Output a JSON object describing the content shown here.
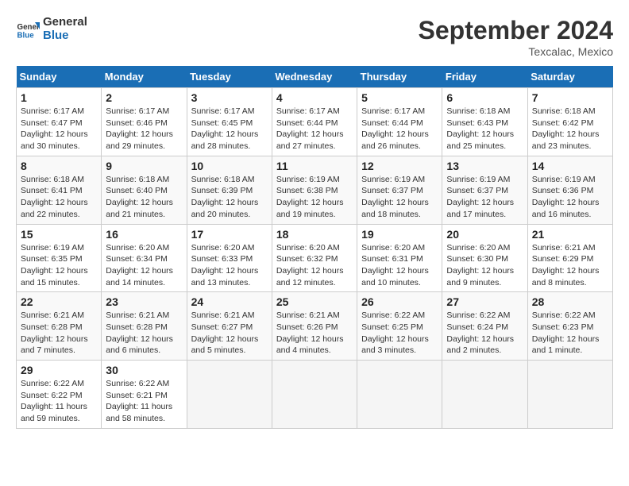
{
  "header": {
    "logo_line1": "General",
    "logo_line2": "Blue",
    "title": "September 2024",
    "location": "Texcalac, Mexico"
  },
  "days_of_week": [
    "Sunday",
    "Monday",
    "Tuesday",
    "Wednesday",
    "Thursday",
    "Friday",
    "Saturday"
  ],
  "weeks": [
    [
      {
        "day": "1",
        "info": "Sunrise: 6:17 AM\nSunset: 6:47 PM\nDaylight: 12 hours and 30 minutes."
      },
      {
        "day": "2",
        "info": "Sunrise: 6:17 AM\nSunset: 6:46 PM\nDaylight: 12 hours and 29 minutes."
      },
      {
        "day": "3",
        "info": "Sunrise: 6:17 AM\nSunset: 6:45 PM\nDaylight: 12 hours and 28 minutes."
      },
      {
        "day": "4",
        "info": "Sunrise: 6:17 AM\nSunset: 6:44 PM\nDaylight: 12 hours and 27 minutes."
      },
      {
        "day": "5",
        "info": "Sunrise: 6:17 AM\nSunset: 6:44 PM\nDaylight: 12 hours and 26 minutes."
      },
      {
        "day": "6",
        "info": "Sunrise: 6:18 AM\nSunset: 6:43 PM\nDaylight: 12 hours and 25 minutes."
      },
      {
        "day": "7",
        "info": "Sunrise: 6:18 AM\nSunset: 6:42 PM\nDaylight: 12 hours and 23 minutes."
      }
    ],
    [
      {
        "day": "8",
        "info": "Sunrise: 6:18 AM\nSunset: 6:41 PM\nDaylight: 12 hours and 22 minutes."
      },
      {
        "day": "9",
        "info": "Sunrise: 6:18 AM\nSunset: 6:40 PM\nDaylight: 12 hours and 21 minutes."
      },
      {
        "day": "10",
        "info": "Sunrise: 6:18 AM\nSunset: 6:39 PM\nDaylight: 12 hours and 20 minutes."
      },
      {
        "day": "11",
        "info": "Sunrise: 6:19 AM\nSunset: 6:38 PM\nDaylight: 12 hours and 19 minutes."
      },
      {
        "day": "12",
        "info": "Sunrise: 6:19 AM\nSunset: 6:37 PM\nDaylight: 12 hours and 18 minutes."
      },
      {
        "day": "13",
        "info": "Sunrise: 6:19 AM\nSunset: 6:37 PM\nDaylight: 12 hours and 17 minutes."
      },
      {
        "day": "14",
        "info": "Sunrise: 6:19 AM\nSunset: 6:36 PM\nDaylight: 12 hours and 16 minutes."
      }
    ],
    [
      {
        "day": "15",
        "info": "Sunrise: 6:19 AM\nSunset: 6:35 PM\nDaylight: 12 hours and 15 minutes."
      },
      {
        "day": "16",
        "info": "Sunrise: 6:20 AM\nSunset: 6:34 PM\nDaylight: 12 hours and 14 minutes."
      },
      {
        "day": "17",
        "info": "Sunrise: 6:20 AM\nSunset: 6:33 PM\nDaylight: 12 hours and 13 minutes."
      },
      {
        "day": "18",
        "info": "Sunrise: 6:20 AM\nSunset: 6:32 PM\nDaylight: 12 hours and 12 minutes."
      },
      {
        "day": "19",
        "info": "Sunrise: 6:20 AM\nSunset: 6:31 PM\nDaylight: 12 hours and 10 minutes."
      },
      {
        "day": "20",
        "info": "Sunrise: 6:20 AM\nSunset: 6:30 PM\nDaylight: 12 hours and 9 minutes."
      },
      {
        "day": "21",
        "info": "Sunrise: 6:21 AM\nSunset: 6:29 PM\nDaylight: 12 hours and 8 minutes."
      }
    ],
    [
      {
        "day": "22",
        "info": "Sunrise: 6:21 AM\nSunset: 6:28 PM\nDaylight: 12 hours and 7 minutes."
      },
      {
        "day": "23",
        "info": "Sunrise: 6:21 AM\nSunset: 6:28 PM\nDaylight: 12 hours and 6 minutes."
      },
      {
        "day": "24",
        "info": "Sunrise: 6:21 AM\nSunset: 6:27 PM\nDaylight: 12 hours and 5 minutes."
      },
      {
        "day": "25",
        "info": "Sunrise: 6:21 AM\nSunset: 6:26 PM\nDaylight: 12 hours and 4 minutes."
      },
      {
        "day": "26",
        "info": "Sunrise: 6:22 AM\nSunset: 6:25 PM\nDaylight: 12 hours and 3 minutes."
      },
      {
        "day": "27",
        "info": "Sunrise: 6:22 AM\nSunset: 6:24 PM\nDaylight: 12 hours and 2 minutes."
      },
      {
        "day": "28",
        "info": "Sunrise: 6:22 AM\nSunset: 6:23 PM\nDaylight: 12 hours and 1 minute."
      }
    ],
    [
      {
        "day": "29",
        "info": "Sunrise: 6:22 AM\nSunset: 6:22 PM\nDaylight: 11 hours and 59 minutes."
      },
      {
        "day": "30",
        "info": "Sunrise: 6:22 AM\nSunset: 6:21 PM\nDaylight: 11 hours and 58 minutes."
      },
      null,
      null,
      null,
      null,
      null
    ]
  ]
}
